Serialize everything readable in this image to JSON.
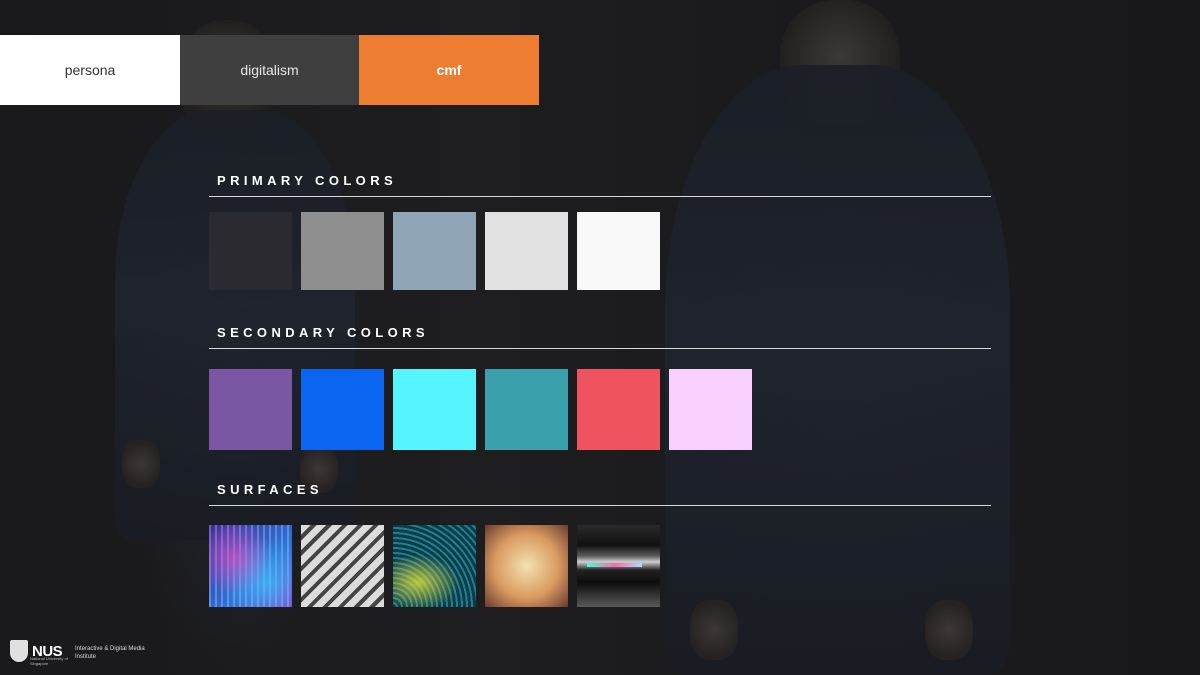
{
  "tabs": [
    {
      "label": "persona"
    },
    {
      "label": "digitalism"
    },
    {
      "label": "cmf",
      "active": true
    }
  ],
  "sections": {
    "primary": {
      "title": "PRIMARY COLORS",
      "swatches": [
        "#2a2a30",
        "#8f8f8f",
        "#8fa4b5",
        "#e1e1e1",
        "#f9f9f9"
      ]
    },
    "secondary": {
      "title": "SECONDARY COLORS",
      "swatches": [
        "#7a57a3",
        "#0a66f0",
        "#56f4fe",
        "#3aa0ab",
        "#ef5360",
        "#f8d0fd"
      ]
    },
    "surfaces": {
      "title": "SURFACES",
      "items": [
        "dotted-gradient-texture",
        "diagonal-stripes-texture",
        "wave-lines-texture",
        "cellular-texture",
        "metallic-tube-texture"
      ]
    }
  },
  "footer": {
    "nus_logo": "NUS",
    "nus_subtitle": "National University of Singapore",
    "institute": "Interactive & Digital Media Institute"
  },
  "colors": {
    "accent": "#ed7d31",
    "background": "#1c1c1e"
  }
}
